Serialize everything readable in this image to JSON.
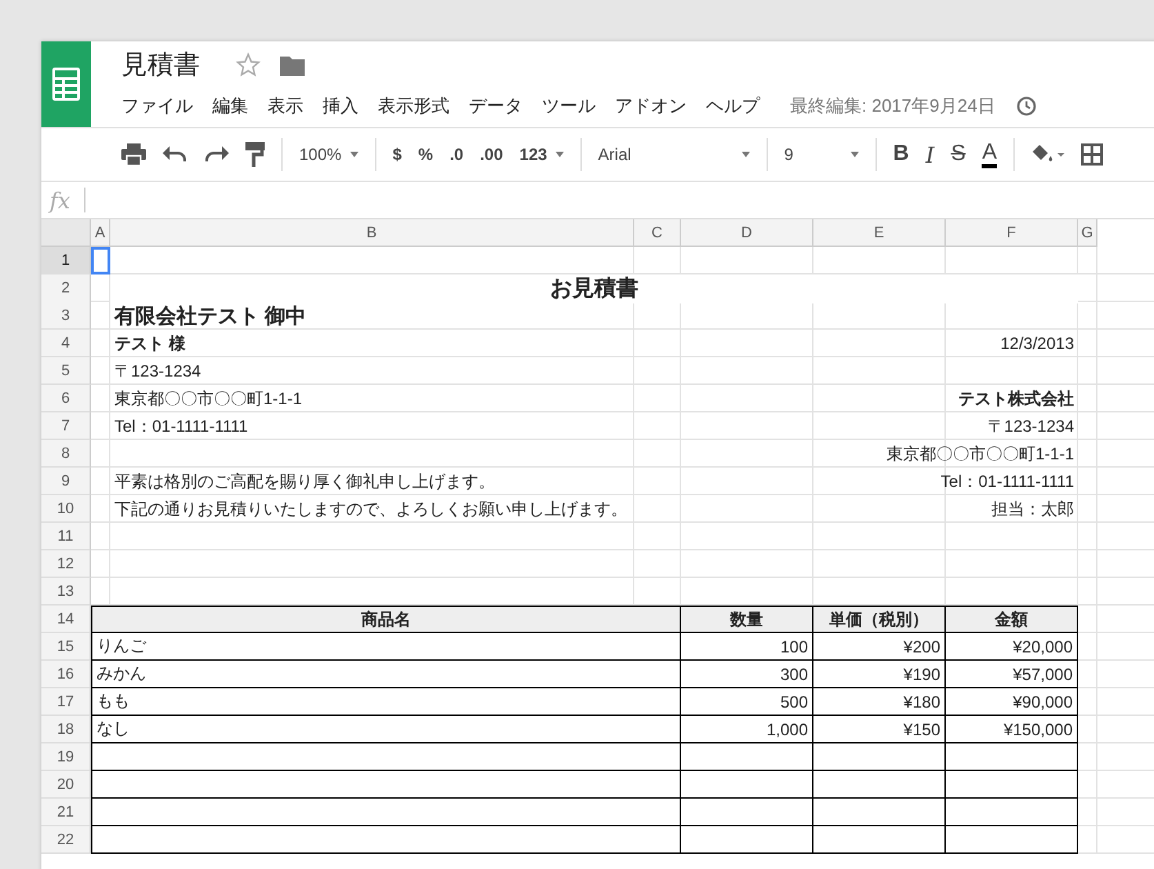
{
  "document": {
    "title": "見積書",
    "last_edit": "最終編集: 2017年9月24日"
  },
  "menu": [
    "ファイル",
    "編集",
    "表示",
    "挿入",
    "表示形式",
    "データ",
    "ツール",
    "アドオン",
    "ヘルプ"
  ],
  "toolbar": {
    "zoom": "100%",
    "currency": "$",
    "percent": "%",
    "decrease_decimals": ".0",
    "increase_decimals": ".00",
    "number_format": "123",
    "font": "Arial",
    "font_size": "9",
    "bold": "B",
    "italic": "I",
    "strikethrough": "S",
    "text_color": "A"
  },
  "formula_bar": {
    "label": "fx"
  },
  "columns": [
    "A",
    "B",
    "C",
    "D",
    "E",
    "F",
    "G"
  ],
  "rows": [
    {
      "number": "1",
      "selected": true,
      "kind": "blank"
    },
    {
      "number": "2",
      "selected": false,
      "kind": "title",
      "text": "お見積書"
    },
    {
      "number": "3",
      "selected": false,
      "kind": "heading",
      "text": "有限会社テスト 御中"
    },
    {
      "number": "4",
      "selected": false,
      "kind": "info",
      "left": {
        "text": "テスト 様",
        "bold": true
      },
      "right": {
        "text": "12/3/2013",
        "bold": false
      }
    },
    {
      "number": "5",
      "selected": false,
      "kind": "info",
      "left": {
        "text": "〒123-1234",
        "bold": false
      }
    },
    {
      "number": "6",
      "selected": false,
      "kind": "info",
      "left": {
        "text": "東京都〇〇市〇〇町1-1-1",
        "bold": false
      },
      "right": {
        "text": "テスト株式会社",
        "bold": true
      }
    },
    {
      "number": "7",
      "selected": false,
      "kind": "info",
      "left": {
        "text": "Tel：01-1111-1111",
        "bold": false
      },
      "right": {
        "text": "〒123-1234",
        "bold": false
      }
    },
    {
      "number": "8",
      "selected": false,
      "kind": "info",
      "right": {
        "text": "東京都〇〇市〇〇町1-1-1",
        "bold": false
      }
    },
    {
      "number": "9",
      "selected": false,
      "kind": "info",
      "left": {
        "text": "平素は格別のご高配を賜り厚く御礼申し上げます。",
        "bold": false
      },
      "right": {
        "text": "Tel：01-1111-1111",
        "bold": false
      }
    },
    {
      "number": "10",
      "selected": false,
      "kind": "info",
      "left": {
        "text": "下記の通りお見積りいたしますので、よろしくお願い申し上げます。",
        "bold": false
      },
      "right": {
        "text": "担当：太郎",
        "bold": false
      }
    },
    {
      "number": "11",
      "selected": false,
      "kind": "blank"
    },
    {
      "number": "12",
      "selected": false,
      "kind": "blank"
    },
    {
      "number": "13",
      "selected": false,
      "kind": "blank"
    },
    {
      "number": "14",
      "selected": false,
      "kind": "table_head",
      "cells": [
        "商品名",
        "数量",
        "単価（税別）",
        "金額"
      ]
    },
    {
      "number": "15",
      "selected": false,
      "kind": "table_row",
      "cells": [
        "りんご",
        "100",
        "¥200",
        "¥20,000"
      ]
    },
    {
      "number": "16",
      "selected": false,
      "kind": "table_row",
      "cells": [
        "みかん",
        "300",
        "¥190",
        "¥57,000"
      ]
    },
    {
      "number": "17",
      "selected": false,
      "kind": "table_row",
      "cells": [
        "もも",
        "500",
        "¥180",
        "¥90,000"
      ]
    },
    {
      "number": "18",
      "selected": false,
      "kind": "table_row",
      "cells": [
        "なし",
        "1,000",
        "¥150",
        "¥150,000"
      ]
    },
    {
      "number": "19",
      "selected": false,
      "kind": "table_row"
    },
    {
      "number": "20",
      "selected": false,
      "kind": "table_row"
    },
    {
      "number": "21",
      "selected": false,
      "kind": "table_row"
    },
    {
      "number": "22",
      "selected": false,
      "kind": "table_row"
    }
  ]
}
